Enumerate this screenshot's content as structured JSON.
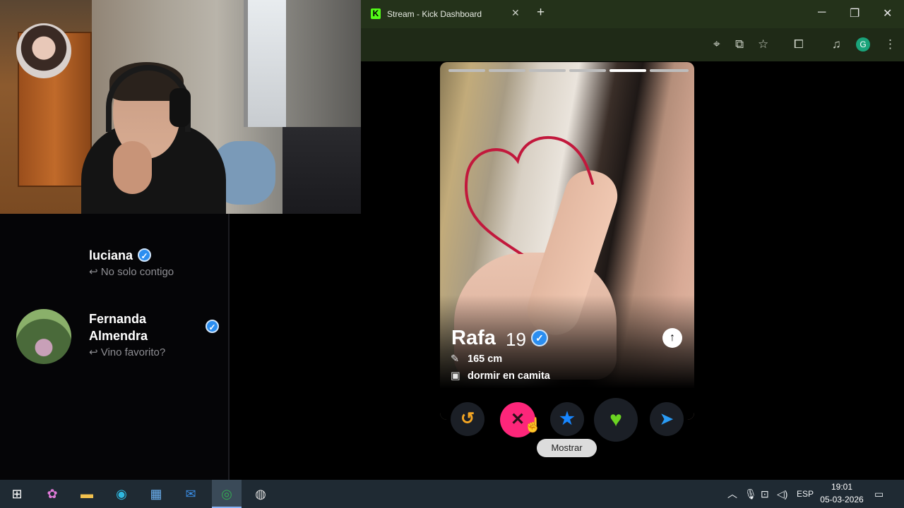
{
  "browser": {
    "tab_title": "Stream - Kick Dashboard",
    "profile_initial": "G"
  },
  "contacts": [
    {
      "name": "luciana",
      "last_message": "↩ No solo contigo",
      "verified": true
    },
    {
      "name_line1": "Fernanda",
      "name_line2": "Almendra",
      "last_message": "↩ Vino favorito?",
      "verified": true
    }
  ],
  "profile": {
    "name": "Rafa",
    "age": "19",
    "verified": true,
    "height": "165 cm",
    "job": "dormir en camita",
    "photo_count": 6,
    "active_photo_index": 4
  },
  "tooltip": "Mostrar",
  "taskbar": {
    "language": "ESP",
    "time": "19:01",
    "date": "05-03-2026"
  },
  "colors": {
    "nope": "#fd267a",
    "like": "#6bd422",
    "superlike": "#1786ff",
    "rewind": "#f5a623",
    "verified": "#2b8ef0",
    "browser_frame": "#24321a"
  }
}
